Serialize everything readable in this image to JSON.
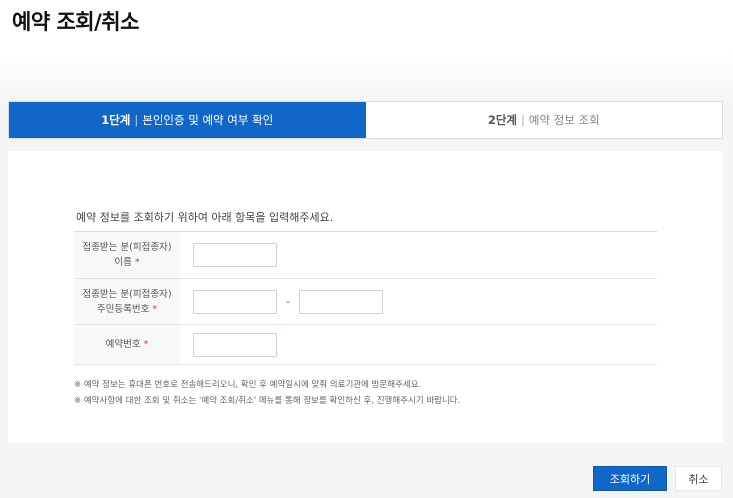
{
  "page": {
    "title": "예약 조회/취소"
  },
  "steps": [
    {
      "num": "1단계",
      "sep": "|",
      "label": "본인인증 및 예약 여부 확인",
      "active": true
    },
    {
      "num": "2단계",
      "sep": "|",
      "label": "예약 정보 조회",
      "active": false
    }
  ],
  "form": {
    "intro": "예약 정보를 조회하기 위하여 아래 항목을 입력해주세요.",
    "name_label_1": "접종받는 분(피접종자)",
    "name_label_2": "이름",
    "rrn_label_1": "접종받는 분(피접종자)",
    "rrn_label_2": "주민등록번호",
    "reservation_label": "예약번호",
    "required_mark": "*",
    "name_value": "",
    "rrn_front_value": "",
    "rrn_back_value": "",
    "reservation_value": "",
    "dash": "-"
  },
  "notes": [
    "※ 예약 정보는 휴대폰 번호로 전송해드리오니, 확인 후 예약일시에 맞춰 의료기관에 방문해주세요.",
    "※ 예약사항에 대한 조회 및 취소는 '예약 조회/취소' 메뉴를 통해 정보를 확인하신 후, 진행해주시기 바랍니다."
  ],
  "buttons": {
    "search": "조회하기",
    "cancel": "취소"
  },
  "colors": {
    "primary": "#1167c8",
    "required": "#e03b3b"
  }
}
